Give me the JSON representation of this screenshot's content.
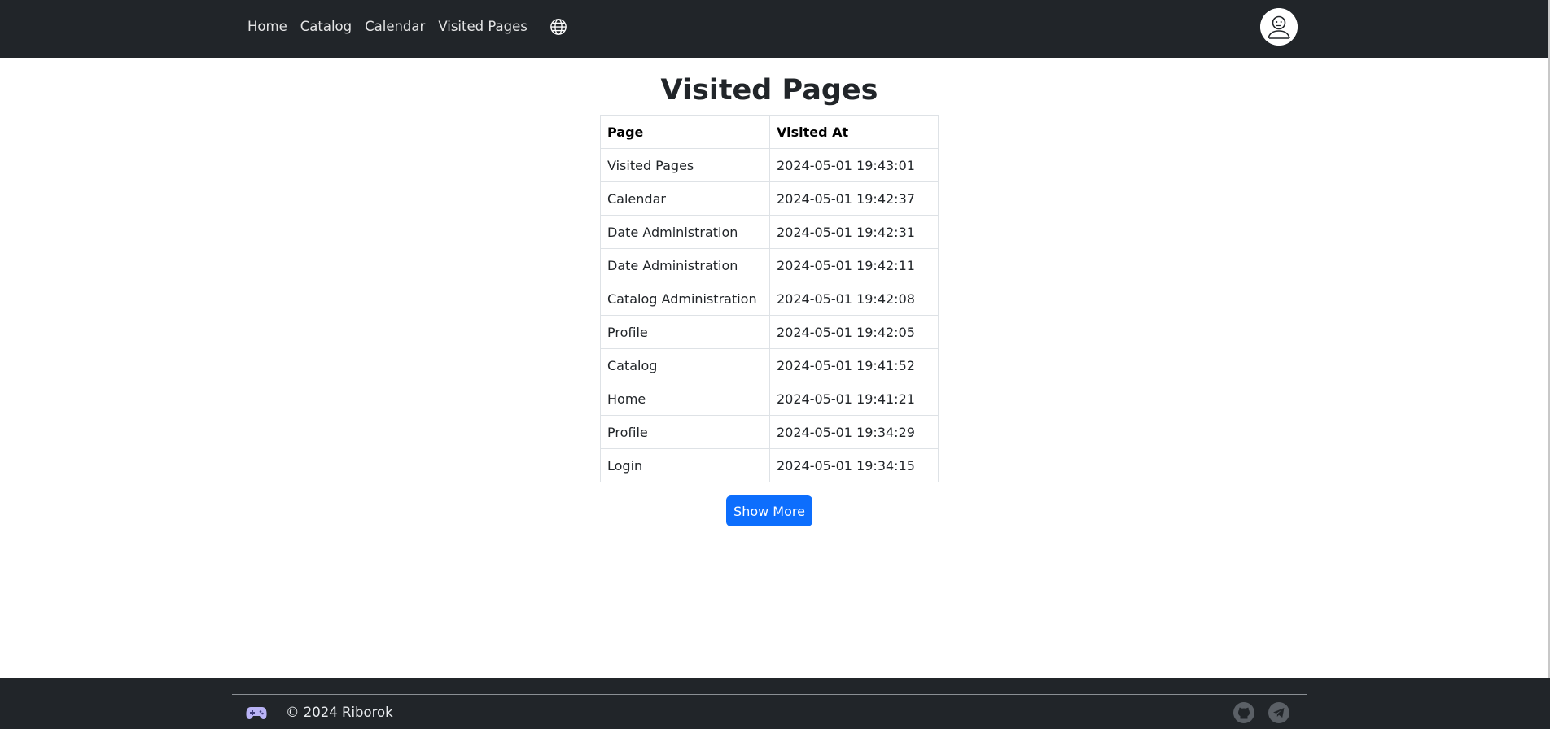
{
  "nav": {
    "links": [
      {
        "label": "Home"
      },
      {
        "label": "Catalog"
      },
      {
        "label": "Calendar"
      },
      {
        "label": "Visited Pages"
      }
    ],
    "language_icon": "globe-icon",
    "avatar_icon": "user-avatar-icon"
  },
  "main": {
    "title": "Visited Pages",
    "table": {
      "headers": [
        "Page",
        "Visited At"
      ],
      "rows": [
        {
          "page": "Visited Pages",
          "visited_at": "2024-05-01 19:43:01"
        },
        {
          "page": "Calendar",
          "visited_at": "2024-05-01 19:42:37"
        },
        {
          "page": "Date Administration",
          "visited_at": "2024-05-01 19:42:31"
        },
        {
          "page": "Date Administration",
          "visited_at": "2024-05-01 19:42:11"
        },
        {
          "page": "Catalog Administration",
          "visited_at": "2024-05-01 19:42:08"
        },
        {
          "page": "Profile",
          "visited_at": "2024-05-01 19:42:05"
        },
        {
          "page": "Catalog",
          "visited_at": "2024-05-01 19:41:52"
        },
        {
          "page": "Home",
          "visited_at": "2024-05-01 19:41:21"
        },
        {
          "page": "Profile",
          "visited_at": "2024-05-01 19:34:29"
        },
        {
          "page": "Login",
          "visited_at": "2024-05-01 19:34:15"
        }
      ]
    },
    "show_more_label": "Show More"
  },
  "footer": {
    "copyright": "© 2024 Riborok",
    "logo_icon": "gamepad-icon",
    "social_icons": [
      "github-icon",
      "telegram-icon"
    ]
  },
  "colors": {
    "navbar_bg": "#212529",
    "accent": "#0d6efd",
    "table_border": "#dee2e6"
  }
}
